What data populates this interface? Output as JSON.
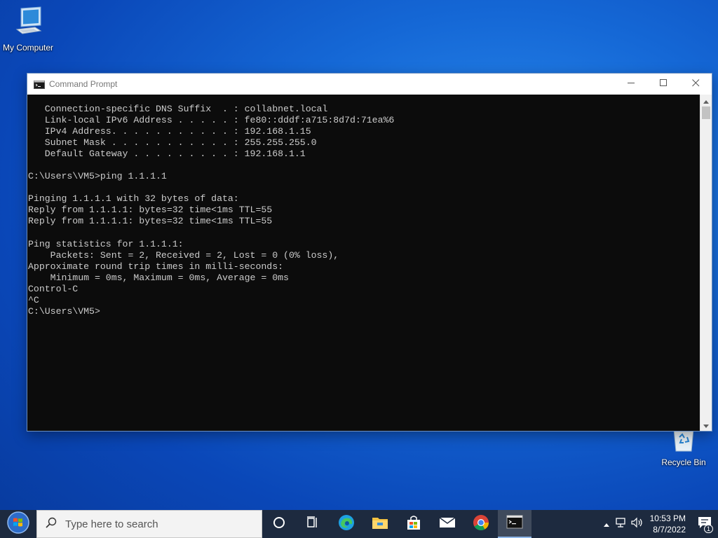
{
  "desktop": {
    "icons": [
      {
        "label": "My Computer",
        "icon": "computer-icon"
      },
      {
        "label": "Recycle Bin",
        "icon": "recycle-bin-icon"
      }
    ]
  },
  "window": {
    "title": "Command Prompt",
    "console_text": "   Connection-specific DNS Suffix  . : collabnet.local\n   Link-local IPv6 Address . . . . . : fe80::dddf:a715:8d7d:71ea%6\n   IPv4 Address. . . . . . . . . . . : 192.168.1.15\n   Subnet Mask . . . . . . . . . . . : 255.255.255.0\n   Default Gateway . . . . . . . . . : 192.168.1.1\n\nC:\\Users\\VM5>ping 1.1.1.1\n\nPinging 1.1.1.1 with 32 bytes of data:\nReply from 1.1.1.1: bytes=32 time<1ms TTL=55\nReply from 1.1.1.1: bytes=32 time<1ms TTL=55\n\nPing statistics for 1.1.1.1:\n    Packets: Sent = 2, Received = 2, Lost = 0 (0% loss),\nApproximate round trip times in milli-seconds:\n    Minimum = 0ms, Maximum = 0ms, Average = 0ms\nControl-C\n^C\nC:\\Users\\VM5>"
  },
  "taskbar": {
    "search_placeholder": "Type here to search",
    "apps": [
      "task-view-icon",
      "cortana-icon",
      "edge-icon",
      "file-explorer-icon",
      "store-icon",
      "mail-icon",
      "chrome-icon",
      "cmd-icon"
    ],
    "clock": {
      "time": "10:53 PM",
      "date": "8/7/2022"
    },
    "notification_count": "1"
  },
  "colors": {
    "console_bg": "#0c0c0c",
    "console_fg": "#cccccc",
    "taskbar_bg": "#1d2a3f"
  }
}
